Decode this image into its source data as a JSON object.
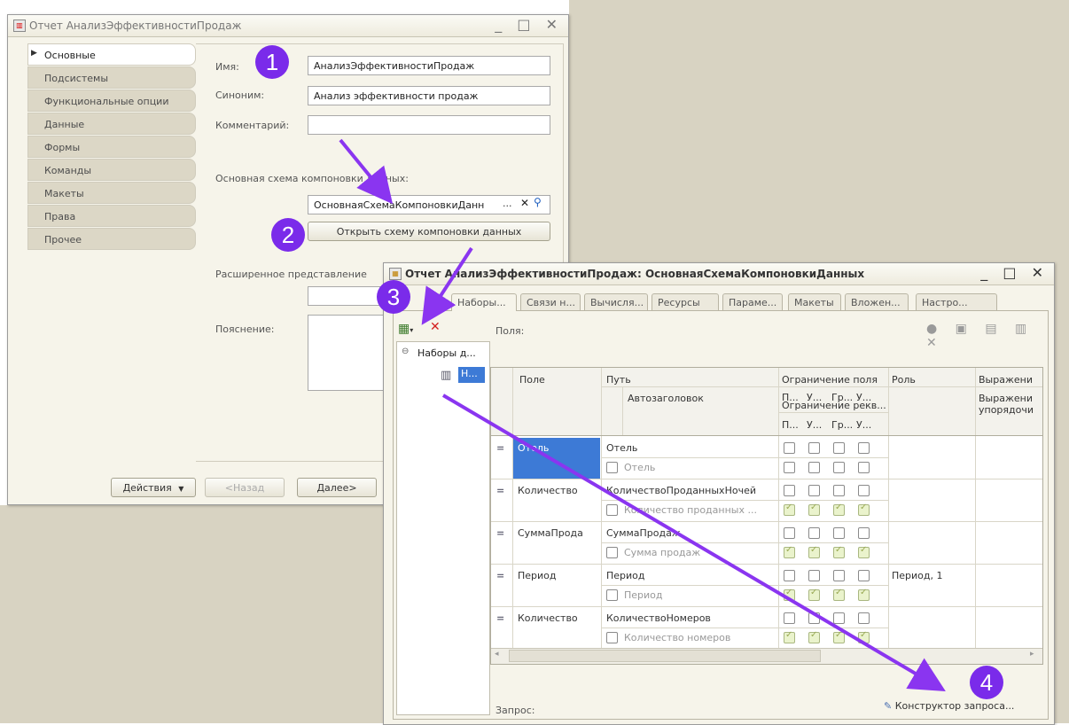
{
  "win1": {
    "title": "Отчет АнализЭффективностиПродаж",
    "tabs": [
      "Основные",
      "Подсистемы",
      "Функциональные опции",
      "Данные",
      "Формы",
      "Команды",
      "Макеты",
      "Права",
      "Прочее"
    ],
    "name_label": "Имя:",
    "name_value": "АнализЭффективностиПродаж",
    "synonym_label": "Синоним:",
    "synonym_value": "Анализ эффективности продаж",
    "comment_label": "Комментарий:",
    "schema_label": "Основная схема компоновки данных:",
    "schema_value": "ОсновнаяСхемаКомпоновкиДанн",
    "open_schema_button": "Открыть схему компоновки данных",
    "extended_label": "Расширенное представление",
    "explanation_label": "Пояснение:",
    "actions_button": "Действия",
    "back_button": "<Назад",
    "next_button": "Далее>"
  },
  "win2": {
    "title": "Отчет АнализЭффективностиПродаж: ОсновнаяСхемаКомпоновкиДанных",
    "tabs": [
      "Наборы...",
      "Связи н...",
      "Вычисля...",
      "Ресурсы",
      "Параме...",
      "Макеты",
      "Вложен...",
      "Настро..."
    ],
    "fields_label": "Поля:",
    "tree_root": "Наборы д...",
    "tree_child": "Н...",
    "headers": {
      "field": "Поле",
      "path": "Путь",
      "autotitle": "Автозаголовок",
      "field_restriction": "Ограничение поля",
      "attr_restriction": "Ограничение рекв...",
      "role": "Роль",
      "expression": "Выражени",
      "expression_order": "Выражени упорядочи",
      "sub": [
        "П...",
        "У...",
        "Гр...",
        "У..."
      ]
    },
    "rows": [
      {
        "field": "Отель",
        "path": "Отель",
        "title": "Отель",
        "role": "",
        "top": [
          false,
          false,
          false,
          false
        ],
        "bottom": [
          false,
          false,
          false,
          false
        ]
      },
      {
        "field": "Количество",
        "path": "КоличествоПроданныхНочей",
        "title": "Количество проданных ...",
        "role": "",
        "top": [
          false,
          false,
          false,
          false
        ],
        "bottom": [
          true,
          true,
          true,
          true
        ]
      },
      {
        "field": "СуммаПрода",
        "path": "СуммаПродаж",
        "title": "Сумма продаж",
        "role": "",
        "top": [
          false,
          false,
          false,
          false
        ],
        "bottom": [
          true,
          true,
          true,
          true
        ]
      },
      {
        "field": "Период",
        "path": "Период",
        "title": "Период",
        "role": "Период, 1",
        "top": [
          false,
          false,
          false,
          false
        ],
        "bottom": [
          true,
          true,
          true,
          true
        ]
      },
      {
        "field": "Количество",
        "path": "КоличествоНомеров",
        "title": "Количество номеров",
        "role": "",
        "top": [
          false,
          false,
          false,
          false
        ],
        "bottom": [
          true,
          true,
          true,
          true
        ]
      }
    ],
    "query_label": "Запрос:",
    "query_builder_button": "Конструктор запроса..."
  },
  "markers": [
    "1",
    "2",
    "3",
    "4"
  ],
  "colors": {
    "marker": "#7a2bea",
    "arrow": "#8a35f0"
  }
}
